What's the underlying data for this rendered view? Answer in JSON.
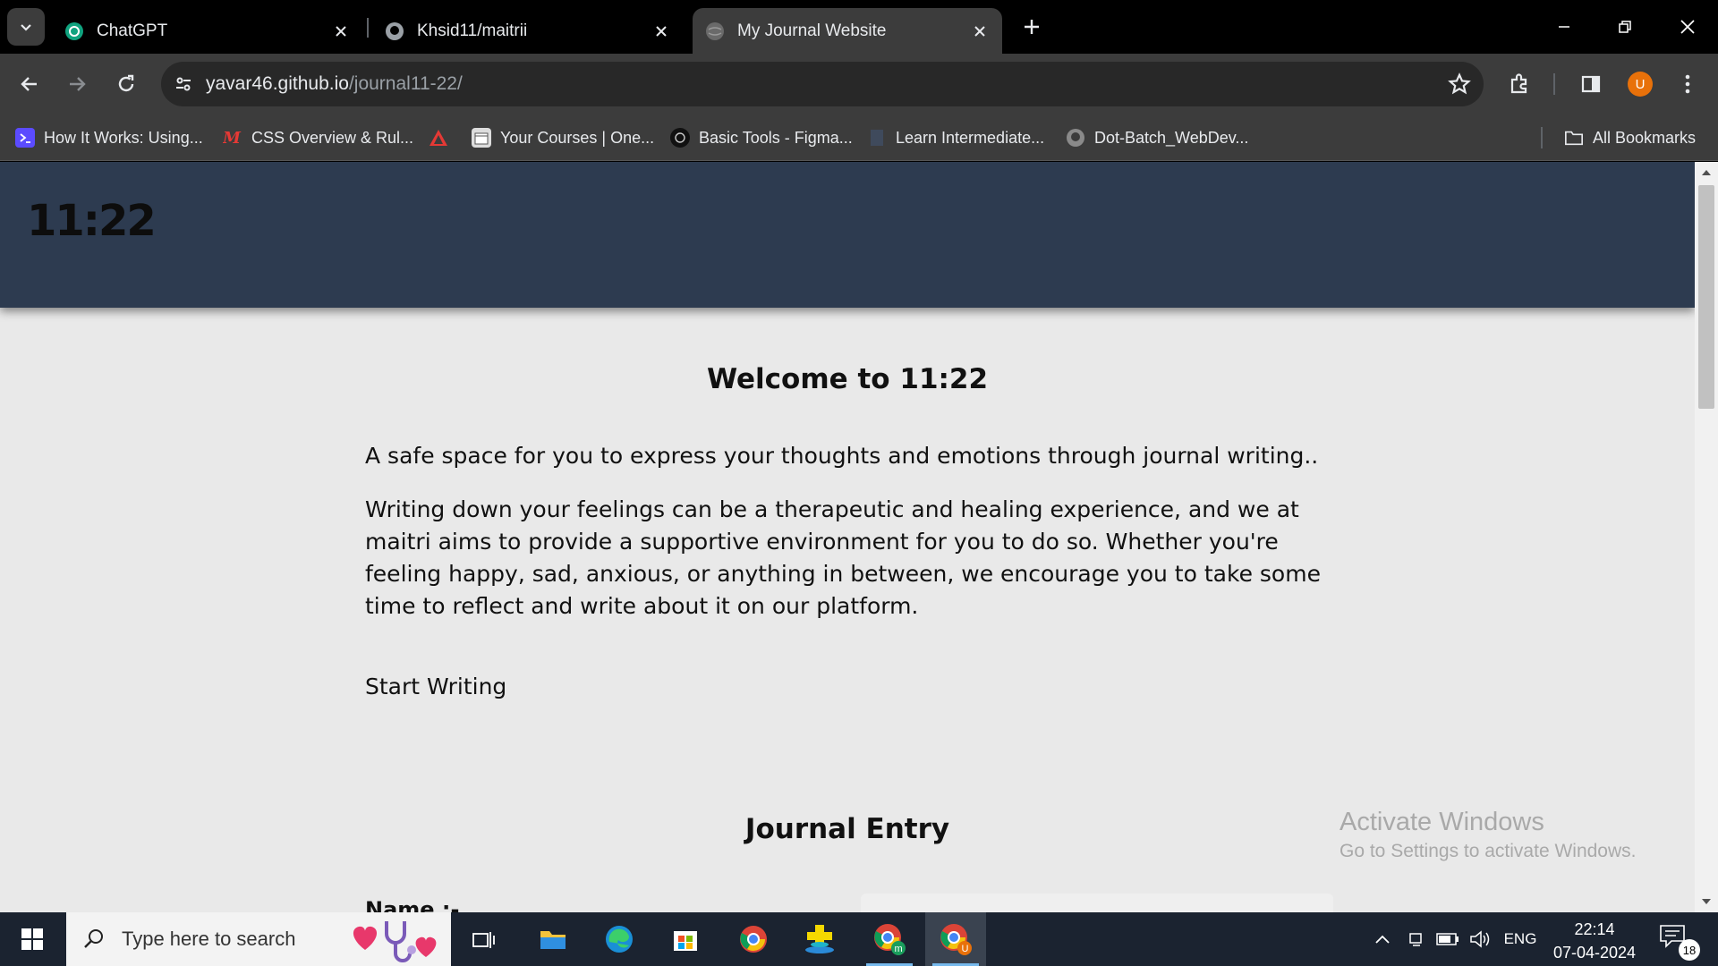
{
  "browser": {
    "tabs": [
      {
        "title": "ChatGPT",
        "favicon": "chatgpt-icon",
        "active": false
      },
      {
        "title": "Khsid11/maitrii",
        "favicon": "github-icon",
        "active": false
      },
      {
        "title": "My Journal Website",
        "favicon": "globe-icon",
        "active": true
      }
    ],
    "address": {
      "host": "yavar46.github.io",
      "path": "/journal11-22/"
    },
    "profile_initial": "U",
    "bookmarks": [
      {
        "label": "How It Works: Using...",
        "icon": "terminal-icon",
        "color": "#5b4bff"
      },
      {
        "label": "CSS Overview & Rul...",
        "icon": "m-logo-icon",
        "color": "#e53935"
      },
      {
        "label": "",
        "icon": "warning-triangle-icon",
        "color": "#e53935"
      },
      {
        "label": "Your Courses | One...",
        "icon": "calendar-icon",
        "color": "#dddddd"
      },
      {
        "label": "Basic Tools - Figma...",
        "icon": "figma-icon",
        "color": "#222222"
      },
      {
        "label": "Learn Intermediate...",
        "icon": "page-icon",
        "color": "#4a5870"
      },
      {
        "label": "Dot-Batch_WebDev...",
        "icon": "github-icon",
        "color": "#888888"
      }
    ],
    "all_bookmarks_label": "All Bookmarks"
  },
  "page": {
    "logo": "11:22",
    "welcome_title": "Welcome to 11:22",
    "intro": "A safe space for you to express your thoughts and emotions through journal writing..",
    "body": "Writing down your feelings can be a therapeutic and healing experience, and we at maitri aims to provide a supportive environment for you to do so. Whether you're feeling happy, sad, anxious, or anything in between, we encourage you to take some time to reflect and write about it on our platform.",
    "start_link": "Start Writing",
    "journal_title": "Journal Entry",
    "name_label": "Name :-"
  },
  "watermark": {
    "title": "Activate Windows",
    "subtitle": "Go to Settings to activate Windows."
  },
  "taskbar": {
    "search_placeholder": "Type here to search",
    "language": "ENG",
    "time": "22:14",
    "date": "07-04-2024",
    "notification_count": "18"
  }
}
